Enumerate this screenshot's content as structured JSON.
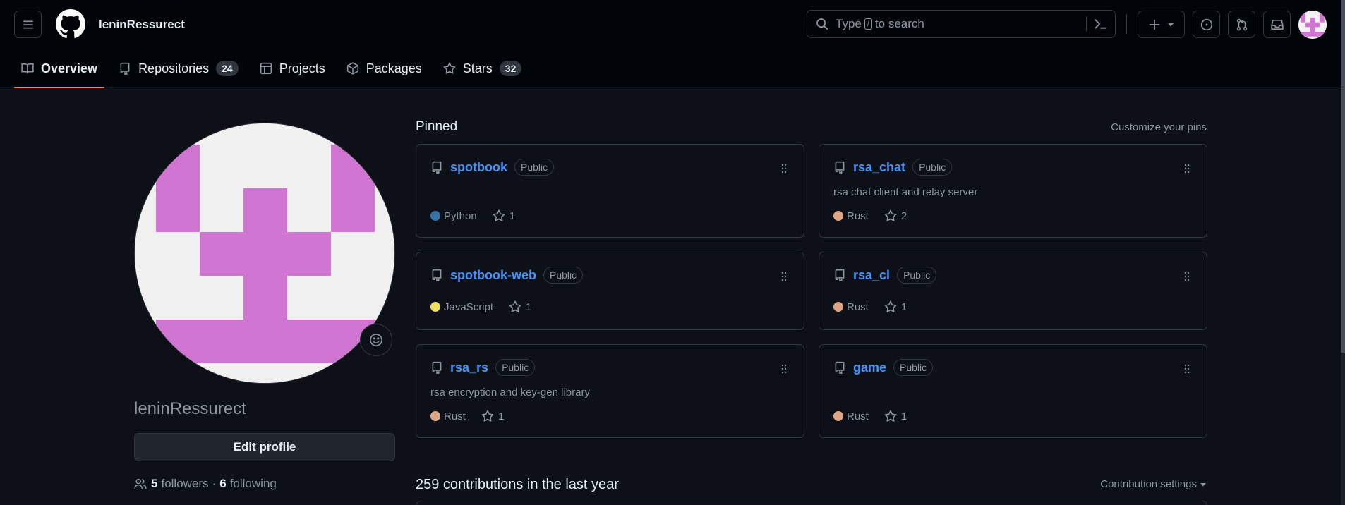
{
  "header": {
    "username": "leninRessurect",
    "search_text_before": "Type",
    "search_key": "/",
    "search_text_after": "to search"
  },
  "tabs": [
    {
      "label": "Overview",
      "counter": null
    },
    {
      "label": "Repositories",
      "counter": "24"
    },
    {
      "label": "Projects",
      "counter": null
    },
    {
      "label": "Packages",
      "counter": null
    },
    {
      "label": "Stars",
      "counter": "32"
    }
  ],
  "profile": {
    "name": "leninRessurect",
    "edit_label": "Edit profile",
    "followers_count": "5",
    "followers_label": "followers",
    "separator": "·",
    "following_count": "6",
    "following_label": "following"
  },
  "pinned": {
    "title": "Pinned",
    "customize_label": "Customize your pins",
    "repos": [
      {
        "name": "spotbook",
        "visibility": "Public",
        "description": "",
        "language": "Python",
        "language_color": "#3572A5",
        "stars": "1"
      },
      {
        "name": "rsa_chat",
        "visibility": "Public",
        "description": "rsa chat client and relay server",
        "language": "Rust",
        "language_color": "#dea584",
        "stars": "2"
      },
      {
        "name": "spotbook-web",
        "visibility": "Public",
        "description": "",
        "language": "JavaScript",
        "language_color": "#f1e05a",
        "stars": "1"
      },
      {
        "name": "rsa_cl",
        "visibility": "Public",
        "description": "",
        "language": "Rust",
        "language_color": "#dea584",
        "stars": "1"
      },
      {
        "name": "rsa_rs",
        "visibility": "Public",
        "description": "rsa encryption and key-gen library",
        "language": "Rust",
        "language_color": "#dea584",
        "stars": "1"
      },
      {
        "name": "game",
        "visibility": "Public",
        "description": "",
        "language": "Rust",
        "language_color": "#dea584",
        "stars": "1"
      }
    ]
  },
  "contributions": {
    "title": "259 contributions in the last year",
    "settings_label": "Contribution settings"
  },
  "colors": {
    "accent_link": "#4493f8",
    "tab_underline": "#f78166",
    "identicon": "#d175d3"
  }
}
